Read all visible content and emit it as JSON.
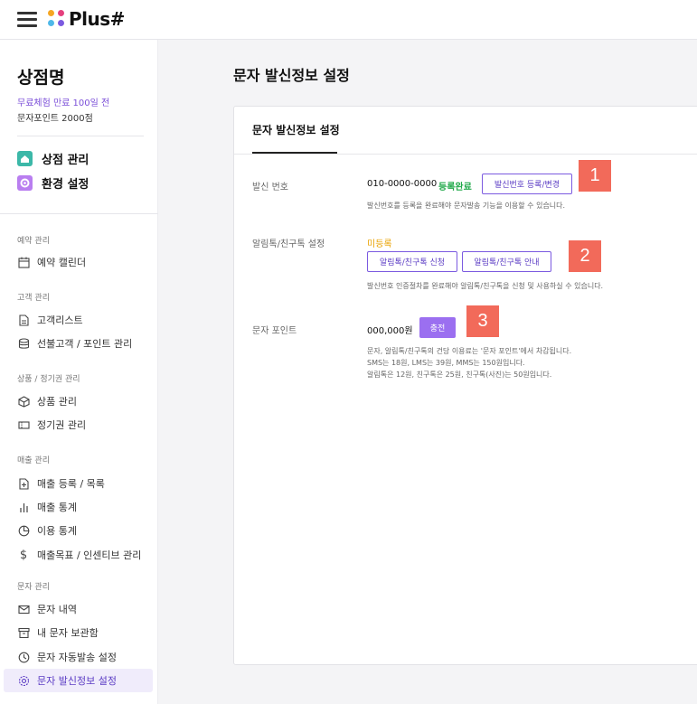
{
  "app": {
    "logo_text": "Plus#"
  },
  "sidebar": {
    "store_name": "상점명",
    "trial_text": "무료체험 만료 100일 전",
    "points_text": "문자포인트 2000점",
    "main_menu": [
      {
        "label": "상점 관리",
        "icon": "home-icon",
        "color": "#3cb8a8"
      },
      {
        "label": "환경 설정",
        "icon": "settings-icon",
        "color": "#b97ef0"
      }
    ],
    "sections": [
      {
        "title": "예약 관리",
        "items": [
          {
            "label": "예약 캘린더",
            "icon": "calendar-icon"
          }
        ]
      },
      {
        "title": "고객 관리",
        "items": [
          {
            "label": "고객리스트",
            "icon": "document-icon"
          },
          {
            "label": "선불고객 / 포인트 관리",
            "icon": "database-icon"
          }
        ]
      },
      {
        "title": "상품 / 정기권 관리",
        "items": [
          {
            "label": "상품 관리",
            "icon": "cube-icon"
          },
          {
            "label": "정기권 관리",
            "icon": "ticket-icon"
          }
        ]
      },
      {
        "title": "매출 관리",
        "items": [
          {
            "label": "매출 등록 / 목록",
            "icon": "file-plus-icon"
          },
          {
            "label": "매출 통계",
            "icon": "bar-chart-icon"
          },
          {
            "label": "이용 통계",
            "icon": "pie-chart-icon"
          },
          {
            "label": "매출목표 / 인센티브 관리",
            "icon": "dollar-icon"
          }
        ]
      },
      {
        "title": "문자 관리",
        "items": [
          {
            "label": "문자 내역",
            "icon": "mail-icon"
          },
          {
            "label": "내 문자 보관함",
            "icon": "archive-icon"
          },
          {
            "label": "문자 자동발송 설정",
            "icon": "clock-icon"
          },
          {
            "label": "문자 발신정보 설정",
            "icon": "gear-icon",
            "active": true
          }
        ]
      }
    ]
  },
  "main": {
    "page_title": "문자 발신정보 설정",
    "tab_label": "문자 발신정보 설정",
    "sender": {
      "label": "발신 번호",
      "number": "010-0000-0000",
      "status": "등록완료",
      "button": "발신번호 등록/변경",
      "help": "발신번호를 등록을 완료해야 문자발송 기능을 이용할 수 있습니다.",
      "badge": "1"
    },
    "alimtalk": {
      "label": "알림톡/친구톡 설정",
      "status": "미등록",
      "apply_button": "알림톡/친구톡 신청",
      "guide_button": "알림톡/친구톡 안내",
      "help": "발신번호 인증절차를 완료해야 알림톡/친구톡을 신청 및 사용하실 수 있습니다.",
      "badge": "2"
    },
    "points": {
      "label": "문자 포인트",
      "amount": "000,000원",
      "charge_button": "충전",
      "help1": "문자, 알림톡/친구톡의 건당 이용료는 '문자 포인트'에서 차감됩니다.",
      "help2": "SMS는 18원, LMS는 39원, MMS는 150원입니다.",
      "help3": "알림톡은 12원, 친구톡은 25원, 친구톡(사진)는 50원입니다.",
      "badge": "3"
    }
  },
  "colors": {
    "accent": "#7b5ae0",
    "badge": "#f26a5a",
    "success": "#21a94a",
    "warning": "#e9a200"
  }
}
